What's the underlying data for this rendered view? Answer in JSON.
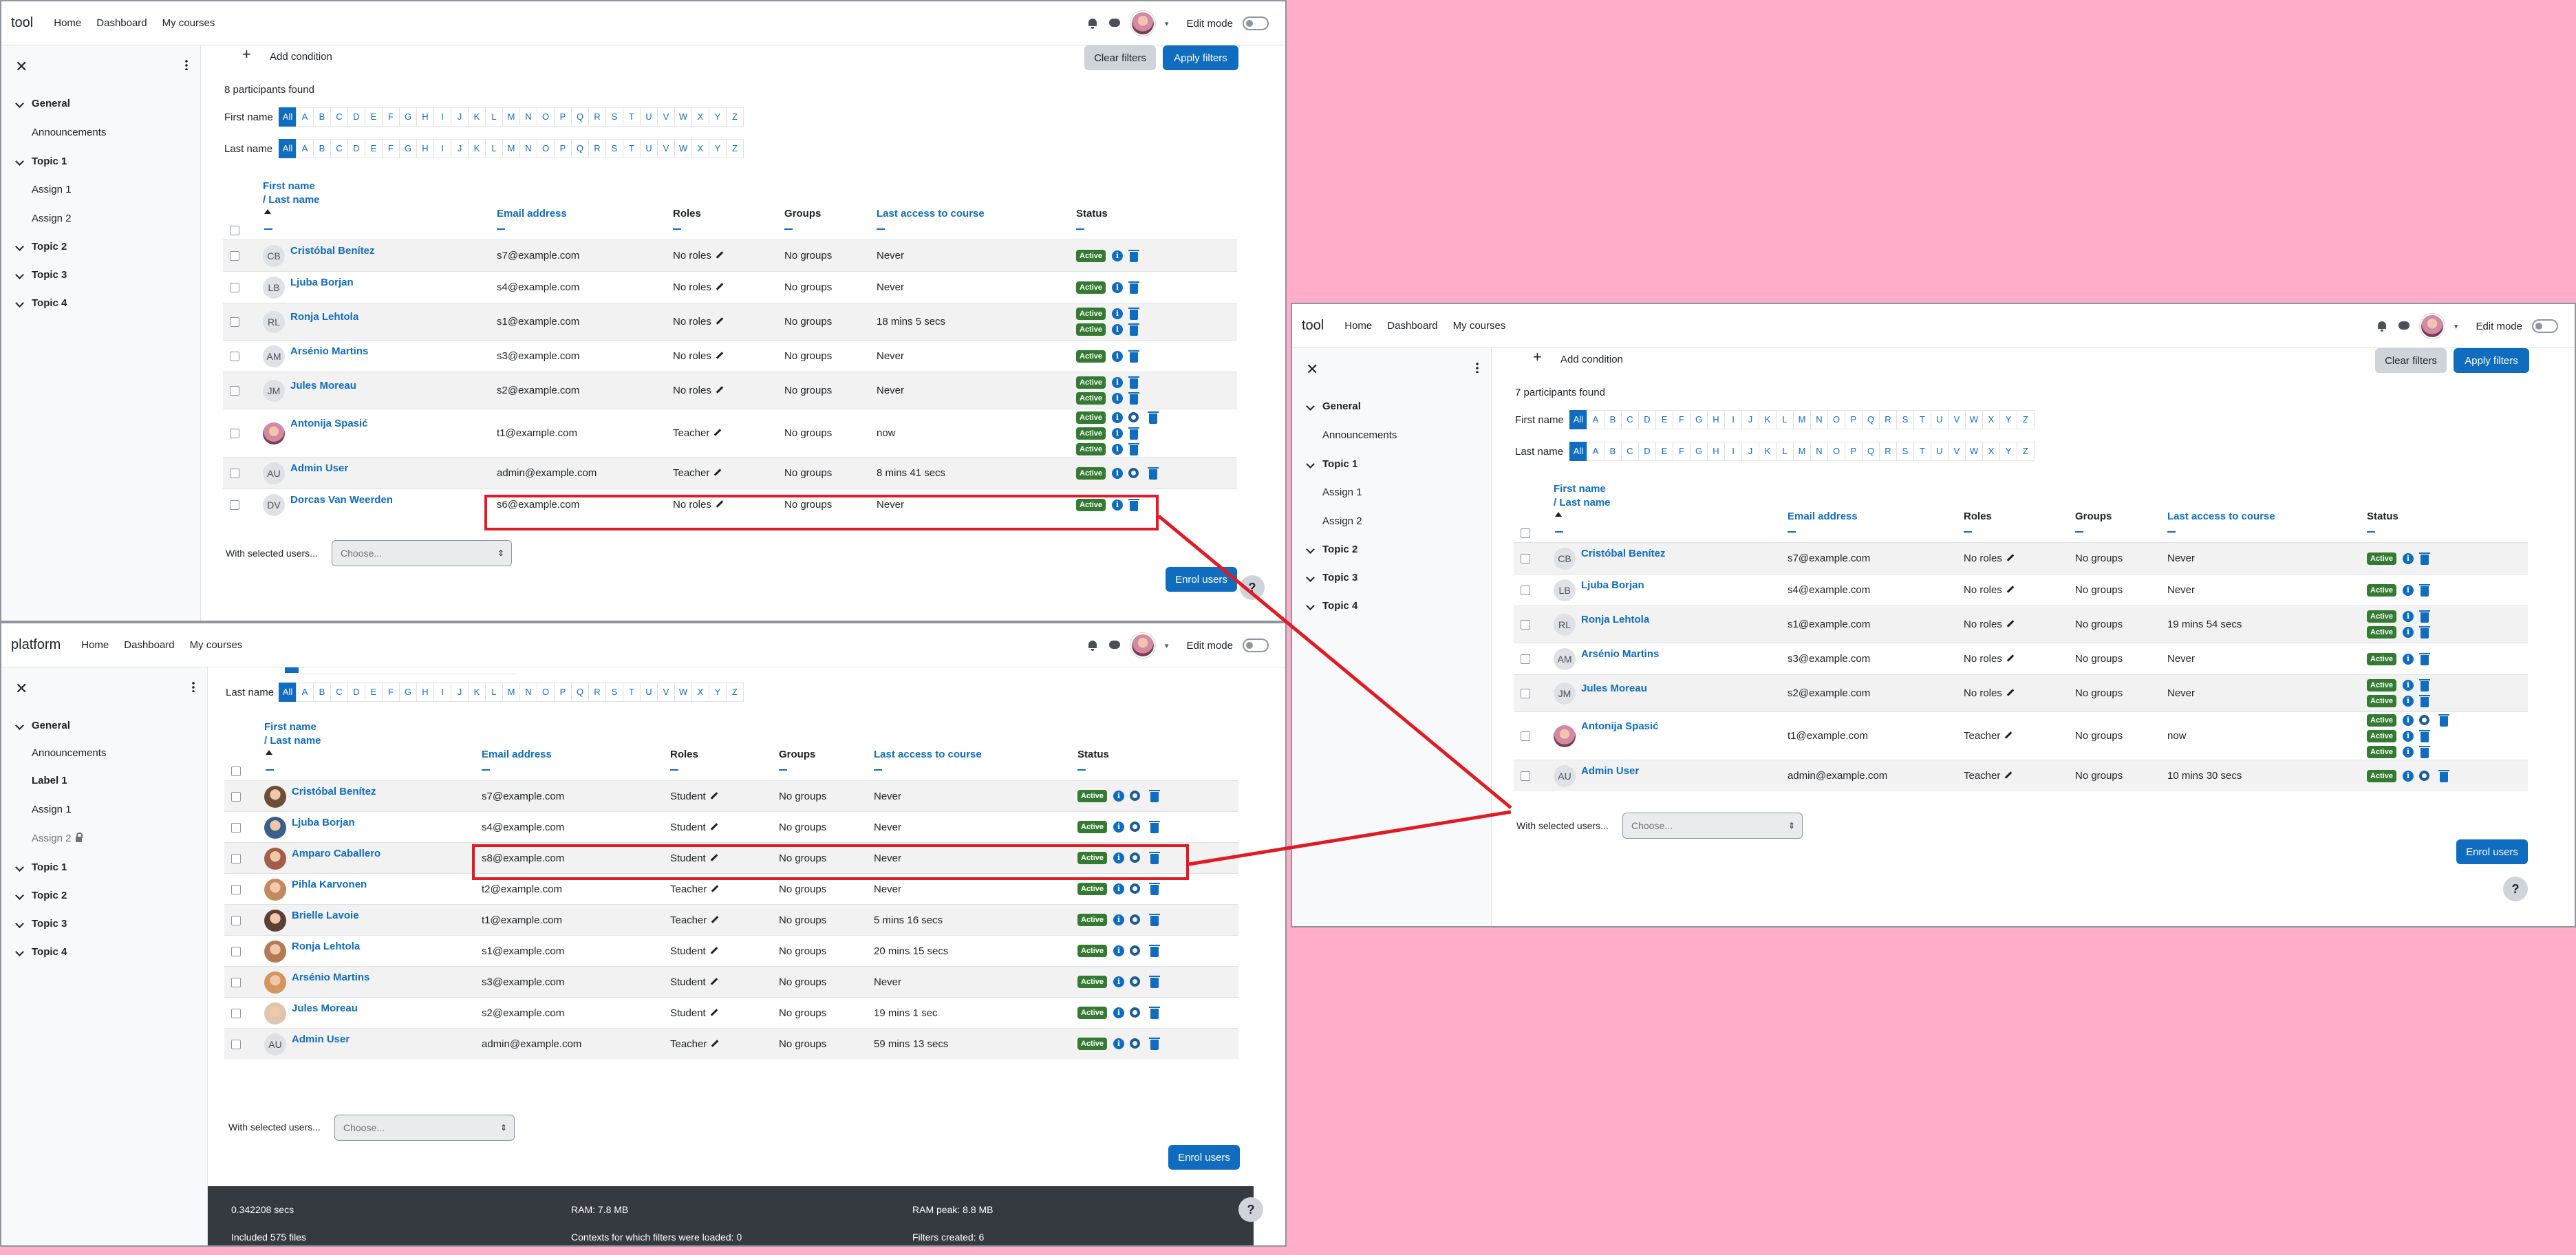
{
  "colors": {
    "accent": "#0f6cbf",
    "success": "#357a32",
    "highlight": "#e01b24",
    "background": "#ffadc8",
    "footer": "#343a40"
  },
  "windowA": {
    "brand": "tool",
    "nav": [
      "Home",
      "Dashboard",
      "My courses"
    ],
    "edit_mode": "Edit mode",
    "drawer": {
      "sections": [
        "General",
        "Topic 1",
        "Topic 2",
        "Topic 3",
        "Topic 4"
      ],
      "activities": [
        "Announcements",
        "Assign 1",
        "Assign 2"
      ]
    },
    "add_condition": "Add condition",
    "clear_filters": "Clear filters",
    "apply_filters": "Apply filters",
    "found": "8 participants found",
    "first_name_label": "First name",
    "last_name_label": "Last name",
    "headers": {
      "first": "First name",
      "last": "/ Last name",
      "email": "Email address",
      "roles": "Roles",
      "groups": "Groups",
      "access": "Last access to course",
      "status": "Status"
    },
    "rows": [
      {
        "initials": "CB",
        "name": "Cristóbal Benítez",
        "email": "s7@example.com",
        "role": "No roles",
        "groups": "No groups",
        "access": "Never"
      },
      {
        "initials": "LB",
        "name": "Ljuba Borjan",
        "email": "s4@example.com",
        "role": "No roles",
        "groups": "No groups",
        "access": "Never"
      },
      {
        "initials": "RL",
        "name": "Ronja Lehtola",
        "email": "s1@example.com",
        "role": "No roles",
        "groups": "No groups",
        "access": "18 mins 5 secs"
      },
      {
        "initials": "AM",
        "name": "Arsénio Martins",
        "email": "s3@example.com",
        "role": "No roles",
        "groups": "No groups",
        "access": "Never"
      },
      {
        "initials": "JM",
        "name": "Jules Moreau",
        "email": "s2@example.com",
        "role": "No roles",
        "groups": "No groups",
        "access": "Never"
      },
      {
        "initials": "",
        "name": "Antonija Spasić",
        "email": "t1@example.com",
        "role": "Teacher",
        "groups": "No groups",
        "access": "now"
      },
      {
        "initials": "AU",
        "name": "Admin User",
        "email": "admin@example.com",
        "role": "Teacher",
        "groups": "No groups",
        "access": "8 mins 41 secs"
      },
      {
        "initials": "DV",
        "name": "Dorcas Van Weerden",
        "email": "s6@example.com",
        "role": "No roles",
        "groups": "No groups",
        "access": "Never"
      }
    ],
    "with_selected": "With selected users...",
    "choose": "Choose...",
    "enrol": "Enrol users",
    "help": "?"
  },
  "windowB": {
    "brand": "tool",
    "nav": [
      "Home",
      "Dashboard",
      "My courses"
    ],
    "edit_mode": "Edit mode",
    "drawer": {
      "sections": [
        "General",
        "Topic 1",
        "Topic 2",
        "Topic 3",
        "Topic 4"
      ],
      "activities": [
        "Announcements",
        "Assign 1",
        "Assign 2"
      ]
    },
    "add_condition": "Add condition",
    "clear_filters": "Clear filters",
    "apply_filters": "Apply filters",
    "found": "7 participants found",
    "first_name_label": "First name",
    "last_name_label": "Last name",
    "headers": {
      "first": "First name",
      "last": "/ Last name",
      "email": "Email address",
      "roles": "Roles",
      "groups": "Groups",
      "access": "Last access to course",
      "status": "Status"
    },
    "rows": [
      {
        "initials": "CB",
        "name": "Cristóbal Benítez",
        "email": "s7@example.com",
        "role": "No roles",
        "groups": "No groups",
        "access": "Never"
      },
      {
        "initials": "LB",
        "name": "Ljuba Borjan",
        "email": "s4@example.com",
        "role": "No roles",
        "groups": "No groups",
        "access": "Never"
      },
      {
        "initials": "RL",
        "name": "Ronja Lehtola",
        "email": "s1@example.com",
        "role": "No roles",
        "groups": "No groups",
        "access": "19 mins 54 secs"
      },
      {
        "initials": "AM",
        "name": "Arsénio Martins",
        "email": "s3@example.com",
        "role": "No roles",
        "groups": "No groups",
        "access": "Never"
      },
      {
        "initials": "JM",
        "name": "Jules Moreau",
        "email": "s2@example.com",
        "role": "No roles",
        "groups": "No groups",
        "access": "Never"
      },
      {
        "initials": "",
        "name": "Antonija Spasić",
        "email": "t1@example.com",
        "role": "Teacher",
        "groups": "No groups",
        "access": "now"
      },
      {
        "initials": "AU",
        "name": "Admin User",
        "email": "admin@example.com",
        "role": "Teacher",
        "groups": "No groups",
        "access": "10 mins 30 secs"
      }
    ],
    "with_selected": "With selected users...",
    "choose": "Choose...",
    "enrol": "Enrol users",
    "help": "?"
  },
  "windowC": {
    "brand": "platform",
    "nav": [
      "Home",
      "Dashboard",
      "My courses"
    ],
    "edit_mode": "Edit mode",
    "drawer": {
      "sections": [
        "General",
        "Topic 1",
        "Topic 2",
        "Topic 3",
        "Topic 4"
      ],
      "activities": [
        "Announcements",
        "Label 1",
        "Assign 1",
        "Assign 2"
      ]
    },
    "last_name_label": "Last name",
    "headers": {
      "first": "First name",
      "last": "/ Last name",
      "email": "Email address",
      "roles": "Roles",
      "groups": "Groups",
      "access": "Last access to course",
      "status": "Status"
    },
    "rows": [
      {
        "name": "Cristóbal Benítez",
        "email": "s7@example.com",
        "role": "Student",
        "groups": "No groups",
        "access": "Never"
      },
      {
        "name": "Ljuba Borjan",
        "email": "s4@example.com",
        "role": "Student",
        "groups": "No groups",
        "access": "Never"
      },
      {
        "name": "Amparo Caballero",
        "email": "s8@example.com",
        "role": "Student",
        "groups": "No groups",
        "access": "Never"
      },
      {
        "name": "Pihla Karvonen",
        "email": "t2@example.com",
        "role": "Teacher",
        "groups": "No groups",
        "access": "Never"
      },
      {
        "name": "Brielle Lavoie",
        "email": "t1@example.com",
        "role": "Teacher",
        "groups": "No groups",
        "access": "5 mins 16 secs"
      },
      {
        "name": "Ronja Lehtola",
        "email": "s1@example.com",
        "role": "Student",
        "groups": "No groups",
        "access": "20 mins 15 secs"
      },
      {
        "name": "Arsénio Martins",
        "email": "s3@example.com",
        "role": "Student",
        "groups": "No groups",
        "access": "Never"
      },
      {
        "name": "Jules Moreau",
        "email": "s2@example.com",
        "role": "Student",
        "groups": "No groups",
        "access": "19 mins 1 sec"
      },
      {
        "initials": "AU",
        "name": "Admin User",
        "email": "admin@example.com",
        "role": "Teacher",
        "groups": "No groups",
        "access": "59 mins 13 secs"
      }
    ],
    "with_selected": "With selected users...",
    "choose": "Choose...",
    "enrol": "Enrol users",
    "help": "?",
    "footer": {
      "secs": "0.342208 secs",
      "ram": "RAM: 7.8 MB",
      "ram_peak": "RAM peak: 8.8 MB",
      "files": "Included 575 files",
      "contexts": "Contexts for which filters were loaded: 0",
      "filters": "Filters created: 6"
    }
  },
  "status_active": "Active",
  "letters": [
    "All",
    "A",
    "B",
    "C",
    "D",
    "E",
    "F",
    "G",
    "H",
    "I",
    "J",
    "K",
    "L",
    "M",
    "N",
    "O",
    "P",
    "Q",
    "R",
    "S",
    "T",
    "U",
    "V",
    "W",
    "X",
    "Y",
    "Z"
  ]
}
